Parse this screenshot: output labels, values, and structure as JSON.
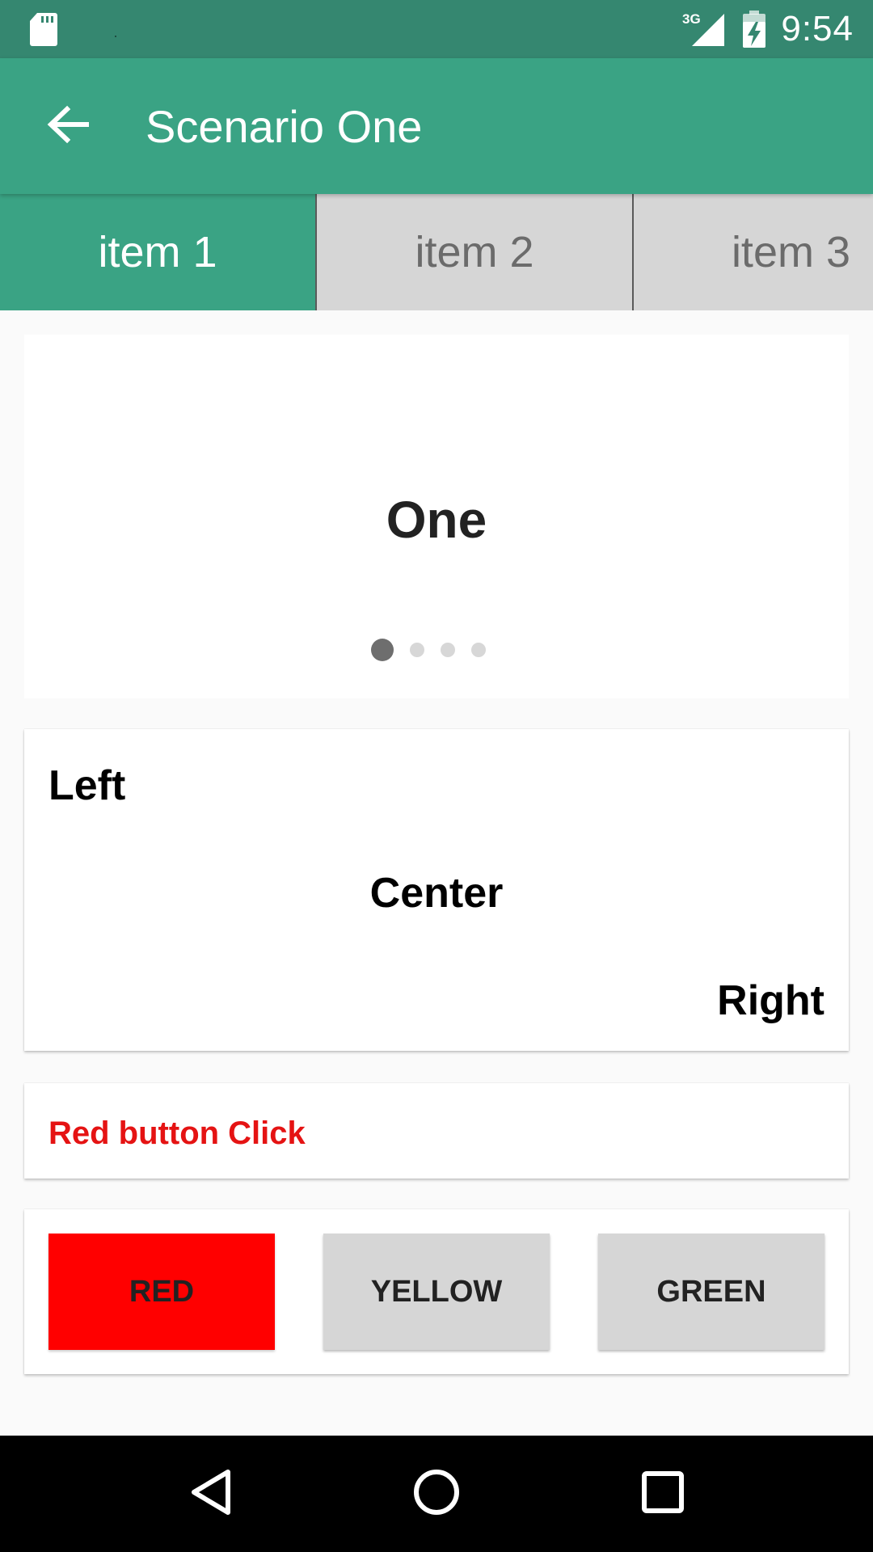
{
  "status_bar": {
    "time": "9:54",
    "network_label": "3G",
    "icons": [
      "sd-card-icon",
      "signal-3g-icon",
      "battery-charging-icon"
    ]
  },
  "app_bar": {
    "title": "Scenario One",
    "back_icon": "arrow-back-icon"
  },
  "tabs": [
    {
      "label": "item 1",
      "active": true
    },
    {
      "label": "item 2",
      "active": false
    },
    {
      "label": "item 3",
      "active": false
    }
  ],
  "pager": {
    "page_text": "One",
    "page_count": 4,
    "current_page": 1
  },
  "alignment_card": {
    "left": "Left",
    "center": "Center",
    "right": "Right"
  },
  "status_card": {
    "message": "Red button Click",
    "message_color": "#e51313"
  },
  "buttons": [
    {
      "label": "RED",
      "color": "#ff0000"
    },
    {
      "label": "YELLOW",
      "color": "#d6d6d6"
    },
    {
      "label": "GREEN",
      "color": "#d6d6d6"
    }
  ],
  "nav_bar": {
    "icons": [
      "back-triangle-icon",
      "home-circle-icon",
      "recents-square-icon"
    ]
  },
  "colors": {
    "primary": "#3aa384",
    "primary_dark": "#358770",
    "tab_inactive": "#d6d6d6"
  }
}
